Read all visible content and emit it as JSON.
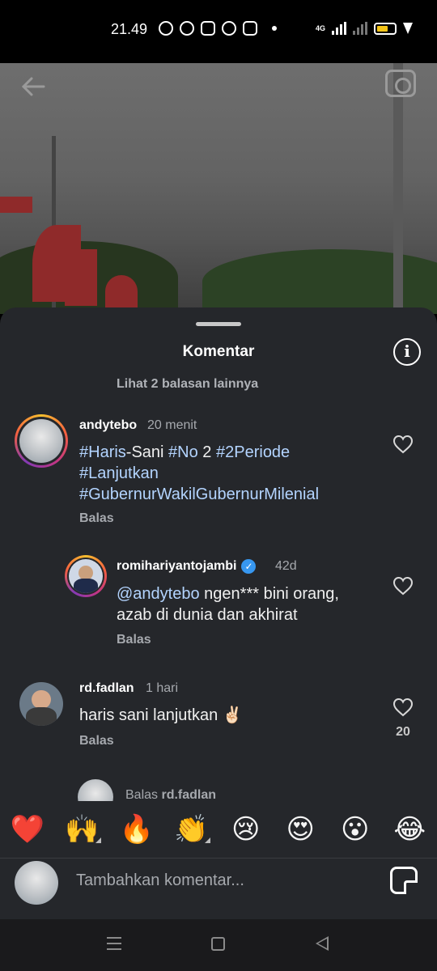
{
  "status_bar": {
    "time": "21.49",
    "network": "4G",
    "app_icons": [
      "whatsapp-icon",
      "messenger-icon",
      "instagram-icon",
      "facebook-icon",
      "tiktok-icon"
    ]
  },
  "sheet": {
    "title": "Komentar",
    "more_replies": "Lihat 2 balasan lainnya"
  },
  "comments": [
    {
      "username": "andytebo",
      "time": "20 menit",
      "line1_parts": [
        "#Haris",
        "-Sani ",
        "#No",
        " 2 ",
        "#2Periode"
      ],
      "line2": "#Lanjutkan",
      "line3": "#GubernurWakilGubernurMilenial",
      "reply_label": "Balas"
    },
    {
      "username": "romihariyantojambi",
      "time": "42d",
      "mention": "@andytebo",
      "text_after_mention": " ngen*** bini orang,",
      "line2": "azab di dunia dan akhirat",
      "reply_label": "Balas"
    },
    {
      "username": "rd.fadlan",
      "time": "1 hari",
      "text": "haris sani lanjutkan ✌🏻",
      "reply_label": "Balas",
      "likes": "20"
    }
  ],
  "partial_reply": {
    "prefix": "Balas ",
    "username": "rd.fadlan"
  },
  "emoji_bar": [
    "❤️",
    "🙌",
    "🔥",
    "👏",
    "😢",
    "😍",
    "😮",
    "😂"
  ],
  "input": {
    "placeholder": "Tambahkan komentar..."
  },
  "colors": {
    "sheet_bg": "#25272b",
    "hashtag": "#b3d4ff",
    "verified": "#3797f0"
  }
}
